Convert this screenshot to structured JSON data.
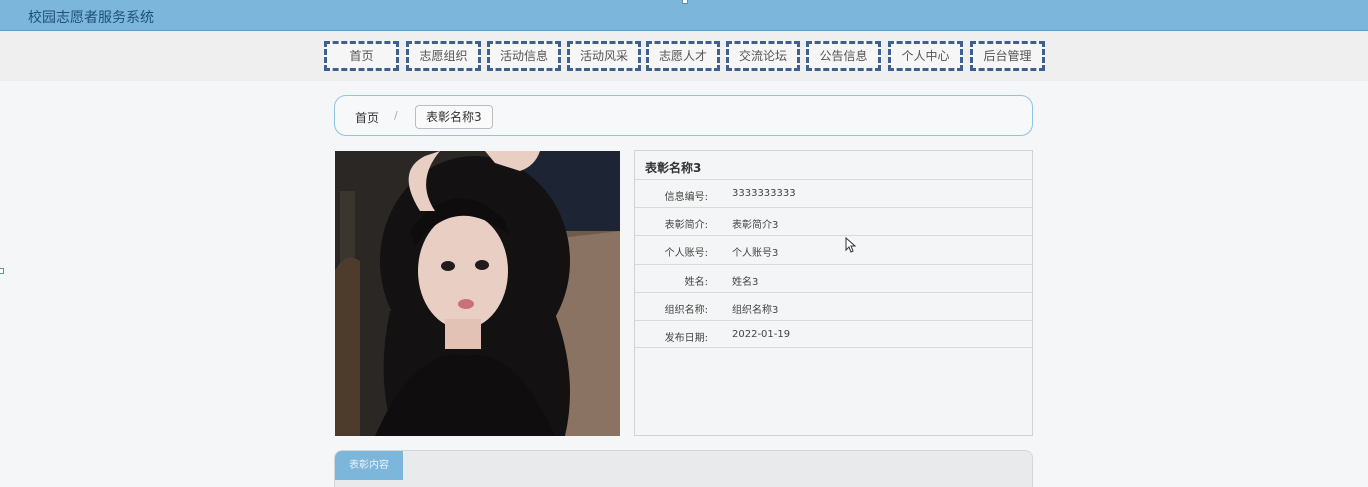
{
  "header": {
    "title": "校园志愿者服务系统"
  },
  "nav": {
    "items": [
      {
        "label": "首页"
      },
      {
        "label": "志愿组织"
      },
      {
        "label": "活动信息"
      },
      {
        "label": "活动风采"
      },
      {
        "label": "志愿人才"
      },
      {
        "label": "交流论坛"
      },
      {
        "label": "公告信息"
      },
      {
        "label": "个人中心"
      },
      {
        "label": "后台管理"
      }
    ]
  },
  "breadcrumb": {
    "home": "首页",
    "separator": "/",
    "current": "表彰名称3"
  },
  "detail": {
    "title": "表彰名称3",
    "fields": [
      {
        "label": "信息编号:",
        "value": "3333333333"
      },
      {
        "label": "表彰简介:",
        "value": "表彰简介3"
      },
      {
        "label": "个人账号:",
        "value": "个人账号3"
      },
      {
        "label": "姓名:",
        "value": "姓名3"
      },
      {
        "label": "组织名称:",
        "value": "组织名称3"
      },
      {
        "label": "发布日期:",
        "value": "2022-01-19"
      }
    ]
  },
  "tabs": {
    "active_label": "表彰内容"
  },
  "colors": {
    "header_bg": "#7db6db",
    "nav_border": "#3f5f8f",
    "accent": "#8ec3e3"
  }
}
